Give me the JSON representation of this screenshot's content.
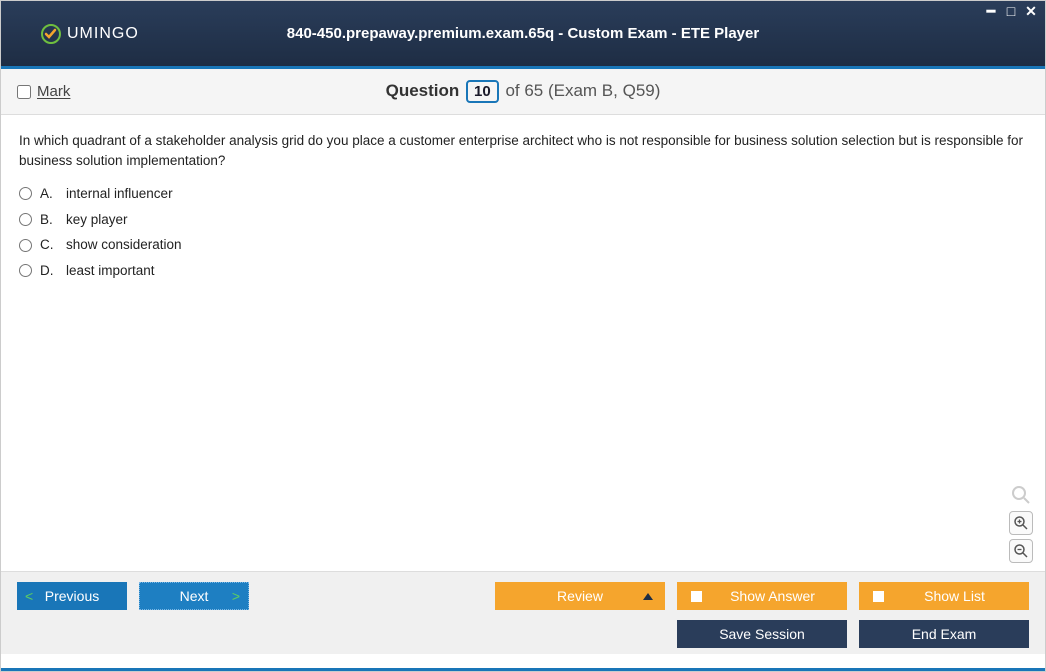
{
  "window": {
    "title": "840-450.prepaway.premium.exam.65q - Custom Exam - ETE Player",
    "logo_text": "UMINGO"
  },
  "header": {
    "mark_label": "Mark",
    "question_word": "Question",
    "current_num": "10",
    "of_text": "of 65 (Exam B, Q59)"
  },
  "question": {
    "text": "In which quadrant of a stakeholder analysis grid do you place a customer enterprise architect who is not responsible for business solution selection but is responsible for business solution implementation?",
    "options": [
      {
        "letter": "A.",
        "text": "internal influencer"
      },
      {
        "letter": "B.",
        "text": "key player"
      },
      {
        "letter": "C.",
        "text": "show consideration"
      },
      {
        "letter": "D.",
        "text": "least important"
      }
    ]
  },
  "footer": {
    "previous": "Previous",
    "next": "Next",
    "review": "Review",
    "show_answer": "Show Answer",
    "show_list": "Show List",
    "save_session": "Save Session",
    "end_exam": "End Exam"
  }
}
